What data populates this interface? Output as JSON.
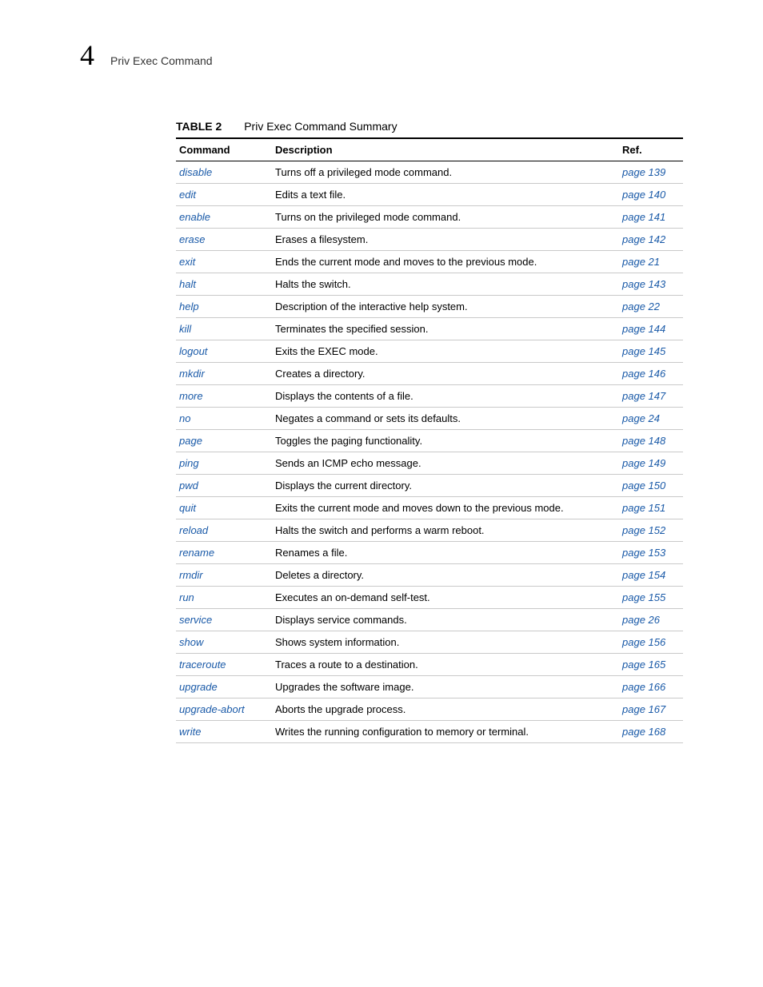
{
  "chapter_number": "4",
  "chapter_title": "Priv Exec Command",
  "table": {
    "label": "TABLE 2",
    "title": "Priv Exec Command Summary",
    "headers": {
      "command": "Command",
      "description": "Description",
      "ref": "Ref."
    },
    "rows": [
      {
        "command": "disable",
        "description": "Turns off a privileged mode command.",
        "ref": "page 139"
      },
      {
        "command": "edit",
        "description": "Edits a text file.",
        "ref": "page 140"
      },
      {
        "command": "enable",
        "description": "Turns on the privileged mode command.",
        "ref": "page 141"
      },
      {
        "command": "erase",
        "description": "Erases a filesystem.",
        "ref": "page 142"
      },
      {
        "command": "exit",
        "description": "Ends the current mode and moves to the previous mode.",
        "ref": "page 21"
      },
      {
        "command": "halt",
        "description": "Halts the switch.",
        "ref": "page 143"
      },
      {
        "command": "help",
        "description": "Description of the interactive help system.",
        "ref": "page 22"
      },
      {
        "command": "kill",
        "description": "Terminates the specified session.",
        "ref": "page 144"
      },
      {
        "command": "logout",
        "description": "Exits the EXEC mode.",
        "ref": "page 145"
      },
      {
        "command": "mkdir",
        "description": "Creates a directory.",
        "ref": "page 146"
      },
      {
        "command": "more",
        "description": "Displays the contents of a file.",
        "ref": "page 147"
      },
      {
        "command": "no",
        "description": "Negates a command or sets its defaults.",
        "ref": "page 24"
      },
      {
        "command": "page",
        "description": "Toggles the paging functionality.",
        "ref": "page 148"
      },
      {
        "command": "ping",
        "description": "Sends an ICMP echo message.",
        "ref": "page 149"
      },
      {
        "command": "pwd",
        "description": "Displays the current directory.",
        "ref": "page 150"
      },
      {
        "command": "quit",
        "description": "Exits the current mode and moves down to the previous mode.",
        "ref": "page 151"
      },
      {
        "command": "reload",
        "description": "Halts the switch and performs a warm reboot.",
        "ref": "page 152"
      },
      {
        "command": "rename",
        "description": "Renames a file.",
        "ref": "page 153"
      },
      {
        "command": "rmdir",
        "description": "Deletes a directory.",
        "ref": "page 154"
      },
      {
        "command": "run",
        "description": "Executes an on-demand self-test.",
        "ref": "page 155"
      },
      {
        "command": "service",
        "description": "Displays service commands.",
        "ref": "page 26"
      },
      {
        "command": "show",
        "description": "Shows system information.",
        "ref": "page 156"
      },
      {
        "command": "traceroute",
        "description": "Traces a route to a destination.",
        "ref": "page 165"
      },
      {
        "command": "upgrade",
        "description": "Upgrades the software image.",
        "ref": "page 166"
      },
      {
        "command": "upgrade-abort",
        "description": "Aborts the upgrade process.",
        "ref": "page 167"
      },
      {
        "command": "write",
        "description": "Writes the running configuration to memory or terminal.",
        "ref": "page 168"
      }
    ]
  }
}
